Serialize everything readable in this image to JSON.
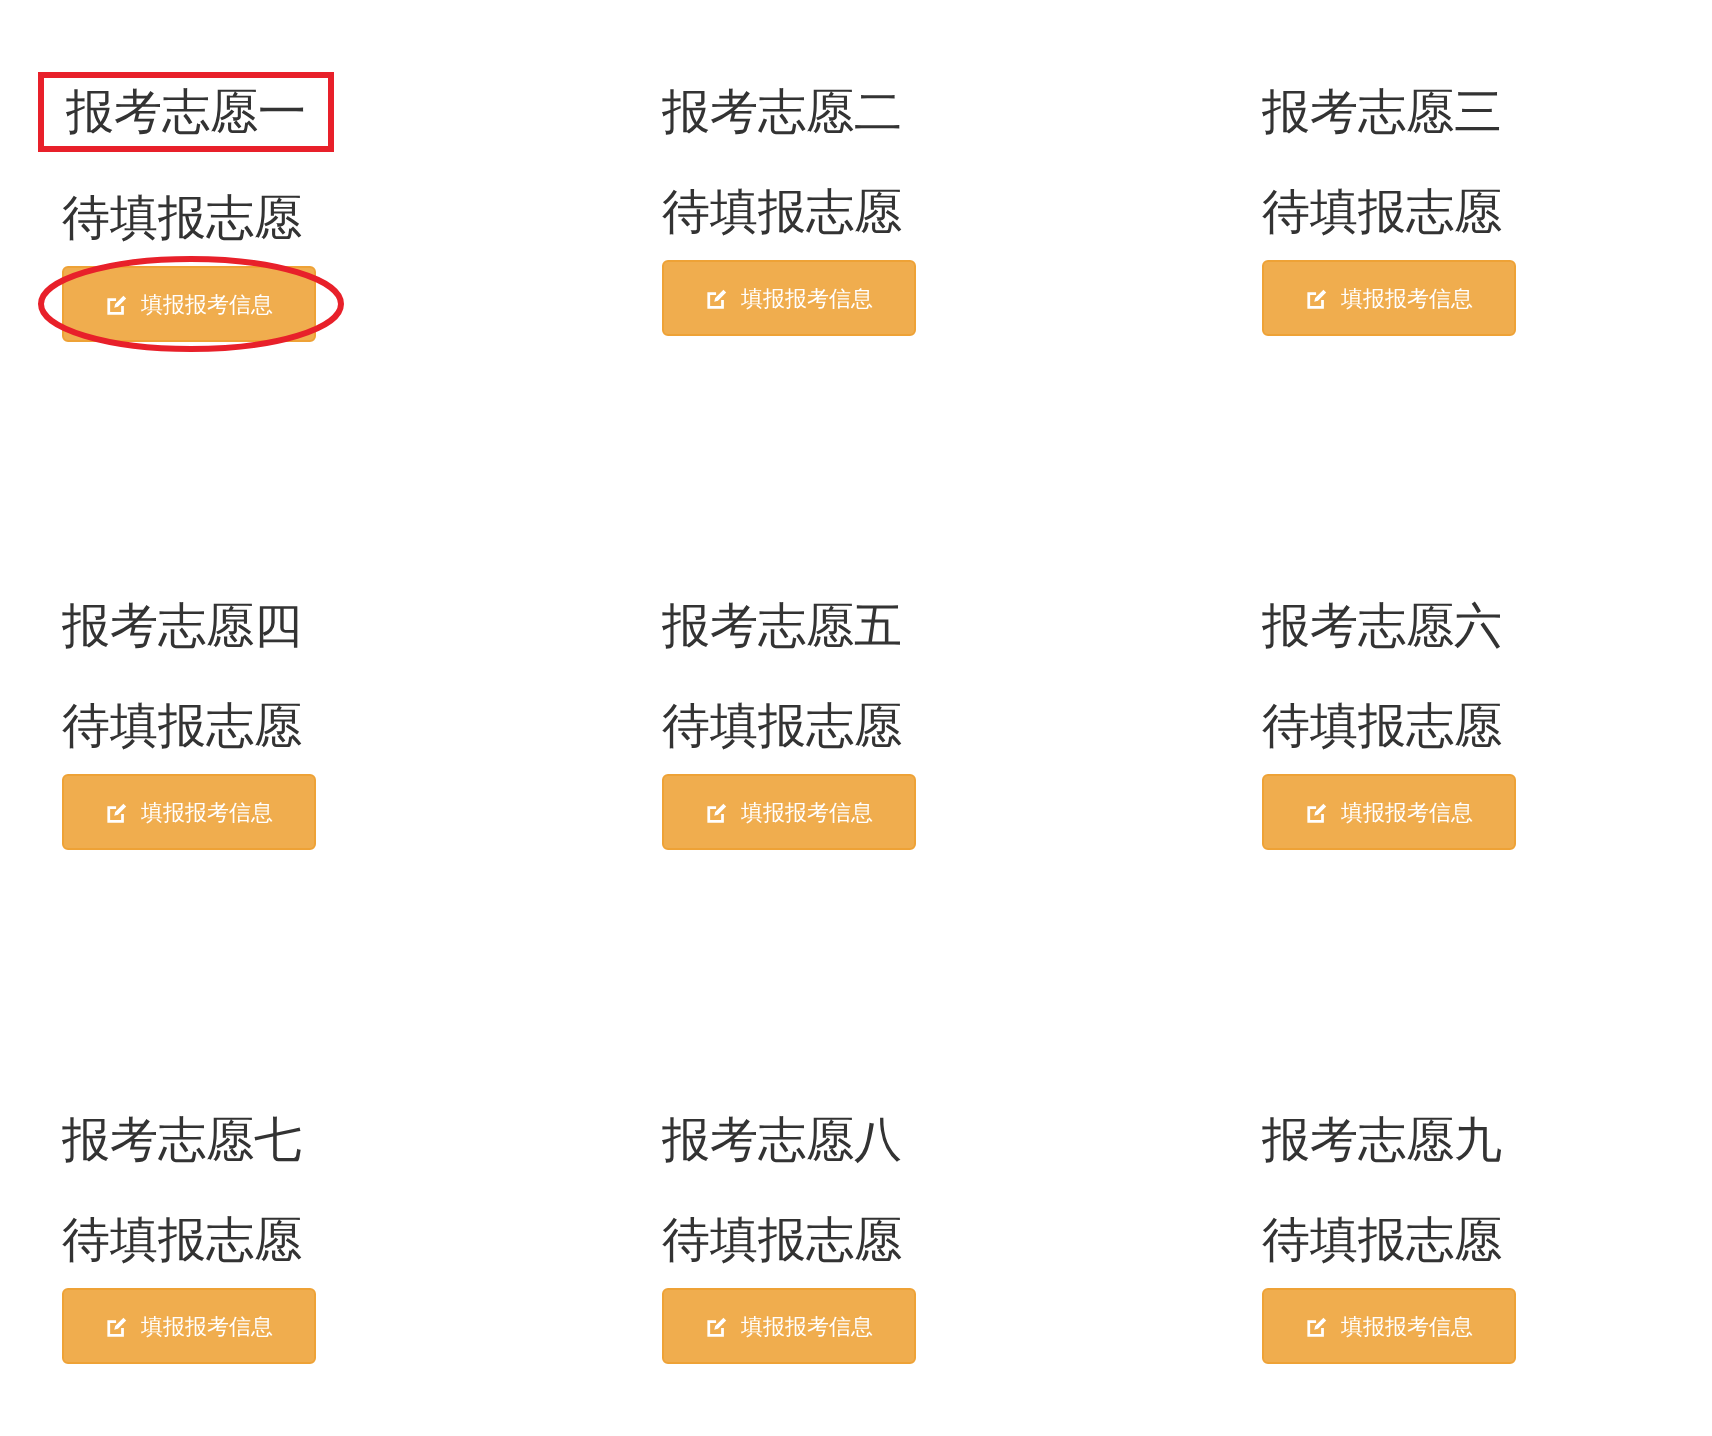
{
  "choices": [
    {
      "title": "报考志愿一",
      "status": "待填报志愿",
      "button": "填报报考信息",
      "annotated": true
    },
    {
      "title": "报考志愿二",
      "status": "待填报志愿",
      "button": "填报报考信息",
      "annotated": false
    },
    {
      "title": "报考志愿三",
      "status": "待填报志愿",
      "button": "填报报考信息",
      "annotated": false
    },
    {
      "title": "报考志愿四",
      "status": "待填报志愿",
      "button": "填报报考信息",
      "annotated": false
    },
    {
      "title": "报考志愿五",
      "status": "待填报志愿",
      "button": "填报报考信息",
      "annotated": false
    },
    {
      "title": "报考志愿六",
      "status": "待填报志愿",
      "button": "填报报考信息",
      "annotated": false
    },
    {
      "title": "报考志愿七",
      "status": "待填报志愿",
      "button": "填报报考信息",
      "annotated": false
    },
    {
      "title": "报考志愿八",
      "status": "待填报志愿",
      "button": "填报报考信息",
      "annotated": false
    },
    {
      "title": "报考志愿九",
      "status": "待填报志愿",
      "button": "填报报考信息",
      "annotated": false
    }
  ]
}
